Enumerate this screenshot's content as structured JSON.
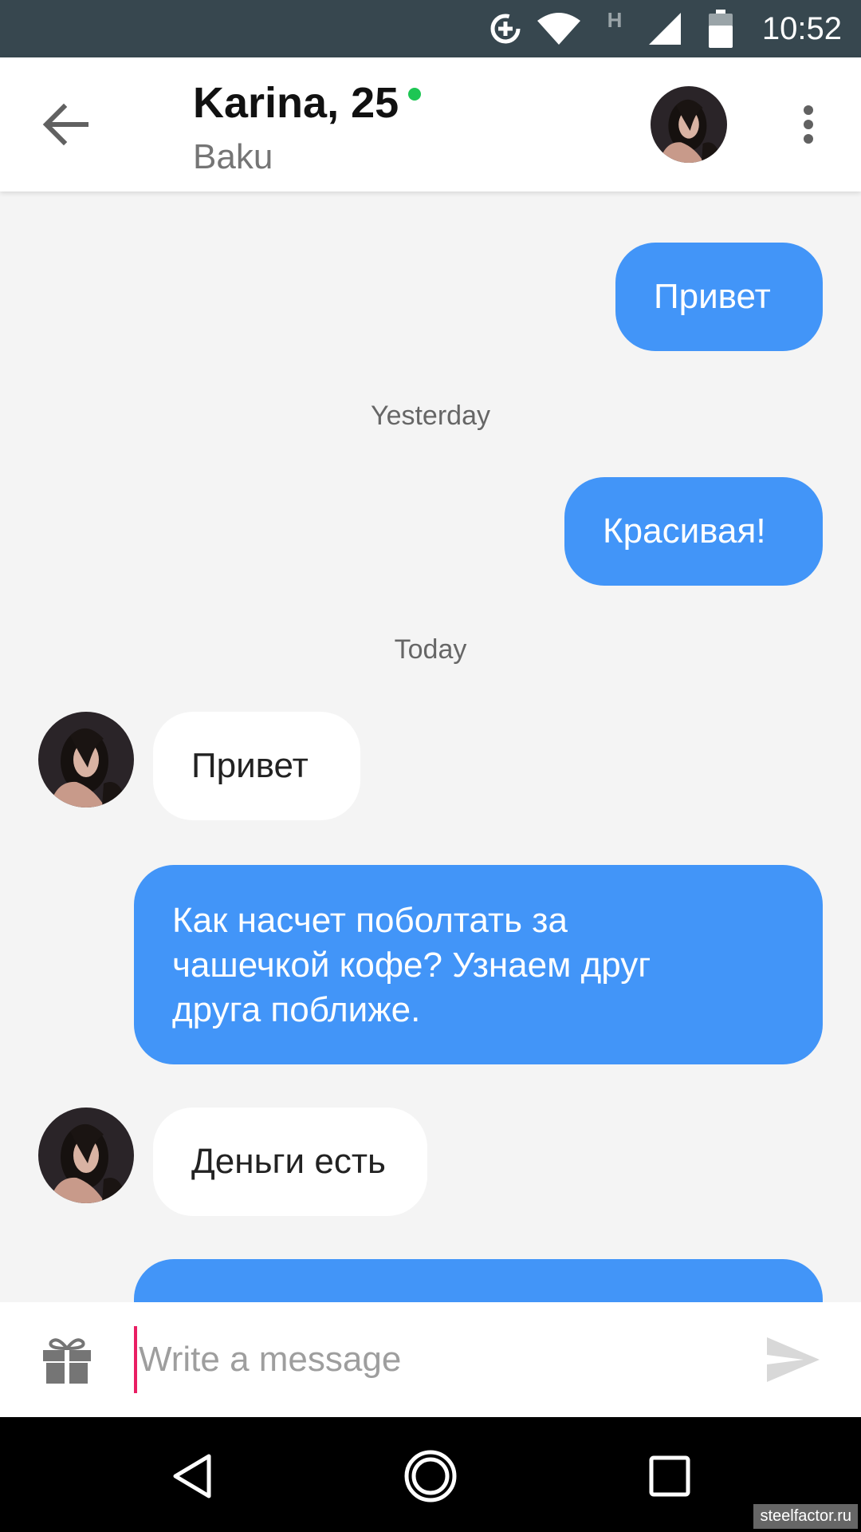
{
  "status_bar": {
    "time": "10:52",
    "network_label": "H",
    "icons": [
      "data-saver-icon",
      "wifi-icon",
      "network-type-icon",
      "cell-signal-icon",
      "battery-icon"
    ]
  },
  "header": {
    "name_age": "Karina, 25",
    "city": "Baku",
    "online": true,
    "online_color": "#1ec654"
  },
  "messages": [
    {
      "direction": "out",
      "text": "Привет"
    },
    {
      "type": "separator",
      "text": "Yesterday"
    },
    {
      "direction": "out",
      "text": "Красивая!"
    },
    {
      "type": "separator",
      "text": "Today"
    },
    {
      "direction": "in",
      "text": "Привет"
    },
    {
      "direction": "out",
      "lines": [
        "Как насчет поболтать за",
        "чашечкой кофе? Узнаем друг",
        "друга поближе."
      ]
    },
    {
      "direction": "in",
      "text": "Деньги есть"
    }
  ],
  "input": {
    "placeholder": "Write a message",
    "value": ""
  },
  "colors": {
    "outgoing_bubble": "#4295f8",
    "incoming_bubble": "#ffffff",
    "chat_background": "#f4f4f4",
    "status_bar": "#37474f",
    "cursor_accent": "#e91e63"
  },
  "watermark": "steelfactor.ru"
}
